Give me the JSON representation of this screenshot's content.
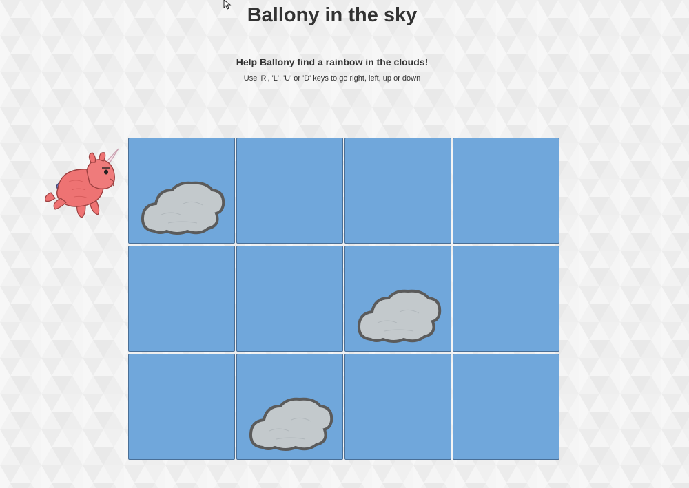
{
  "header": {
    "title": "Ballony in the sky",
    "subtitle": "Help Ballony find a rainbow in the clouds!",
    "instructions": "Use 'R', 'L', 'U' or 'D' keys to go right, left, up or down"
  },
  "board": {
    "rows": 3,
    "cols": 4,
    "cloud_cells": [
      {
        "row": 0,
        "col": 0
      },
      {
        "row": 1,
        "col": 2
      },
      {
        "row": 2,
        "col": 1
      }
    ],
    "player": {
      "row": 0,
      "col": -1,
      "name": "Ballony"
    }
  },
  "controls": [
    "R",
    "L",
    "U",
    "D"
  ],
  "colors": {
    "tile": "#70a7db",
    "tile_border": "#4a6f96",
    "cloud_fill": "#c3c9cc",
    "cloud_outline": "#5b5b5b",
    "ballony_body": "#ee7373",
    "text": "#333333"
  },
  "icons": {
    "cloud": "cloud-icon",
    "player": "pink-unicorn-balloon-icon"
  }
}
